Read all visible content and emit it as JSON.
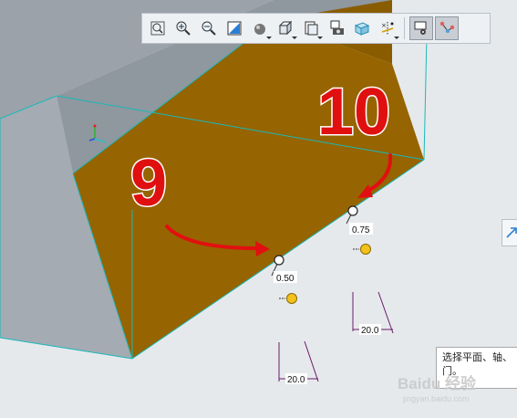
{
  "toolbar": {
    "buttons": [
      {
        "icon": "zoom-fit-icon",
        "label": "Refit"
      },
      {
        "icon": "zoom-in-icon",
        "label": "Zoom In"
      },
      {
        "icon": "zoom-out-icon",
        "label": "Zoom Out"
      },
      {
        "icon": "repaint-icon",
        "label": "Repaint"
      },
      {
        "icon": "display-style-icon",
        "label": "Display Style"
      },
      {
        "icon": "saved-orientations-icon",
        "label": "Saved Orientations"
      },
      {
        "icon": "view-manager-icon",
        "label": "View Manager"
      },
      {
        "icon": "perspective-view-icon",
        "label": "Perspective View"
      },
      {
        "icon": "section-icon",
        "label": "Section"
      },
      {
        "icon": "datum-display-icon",
        "label": "Datum Display Filters"
      },
      {
        "icon": "annotation-display-icon",
        "label": "Annotation Display"
      },
      {
        "icon": "datum-point-tool-icon",
        "label": "Datum Point Tool"
      }
    ]
  },
  "annotations": {
    "big_label_left": "9",
    "big_label_right": "10"
  },
  "points": [
    {
      "ratio": "0.50"
    },
    {
      "ratio": "0.75"
    }
  ],
  "dimensions": {
    "left": "20.0",
    "right": "20.0"
  },
  "tooltip": {
    "text": "选择平面、轴、门。"
  },
  "watermark": {
    "text": "Baidu 经验",
    "sub": "jingyan.baidu.com"
  },
  "colors": {
    "background": "#e6e9ec",
    "solid_face": "#9ea5ad",
    "selected_face": "#966400",
    "edge": "#19b9b9",
    "arrow": "#e01010",
    "handle": "#f2c11b"
  }
}
